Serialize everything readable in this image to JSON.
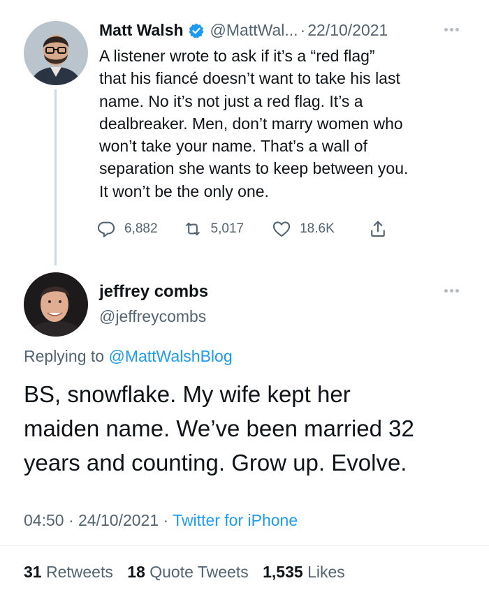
{
  "tweet1": {
    "name": "Matt Walsh",
    "verified": true,
    "handle": "@MattWal...",
    "separator": "·",
    "date": "22/10/2021",
    "text": "A listener wrote to ask if it’s a “red flag”\nthat his fiancé doesn’t want to take his last\nname. No it’s not just a red flag. It’s a\ndealbreaker. Men, don’t marry women who\nwon’t take your name. That’s a wall of\nseparation she wants to keep between you.\nIt won’t be the only one.",
    "replies": "6,882",
    "retweets": "5,017",
    "likes": "18.6K",
    "icons": [
      "reply-icon",
      "retweet-icon",
      "like-icon",
      "share-icon"
    ]
  },
  "tweet2": {
    "name": "jeffrey combs",
    "handle": "@jeffreycombs",
    "replying_prefix": "Replying to ",
    "replying_to": "@MattWalshBlog",
    "text": "BS, snowflake. My wife kept her\nmaiden name. We’ve been married 32\nyears and counting. Grow up. Evolve.",
    "time": "04:50",
    "date": "24/10/2021",
    "source": "Twitter for iPhone",
    "retweets_count": "31",
    "retweets_label": "Retweets",
    "quotes_count": "18",
    "quotes_label": "Quote Tweets",
    "likes_count": "1,535",
    "likes_label": "Likes"
  },
  "colors": {
    "accent": "#1d9bf0",
    "text": "#0f1419",
    "secondary": "#536471"
  }
}
